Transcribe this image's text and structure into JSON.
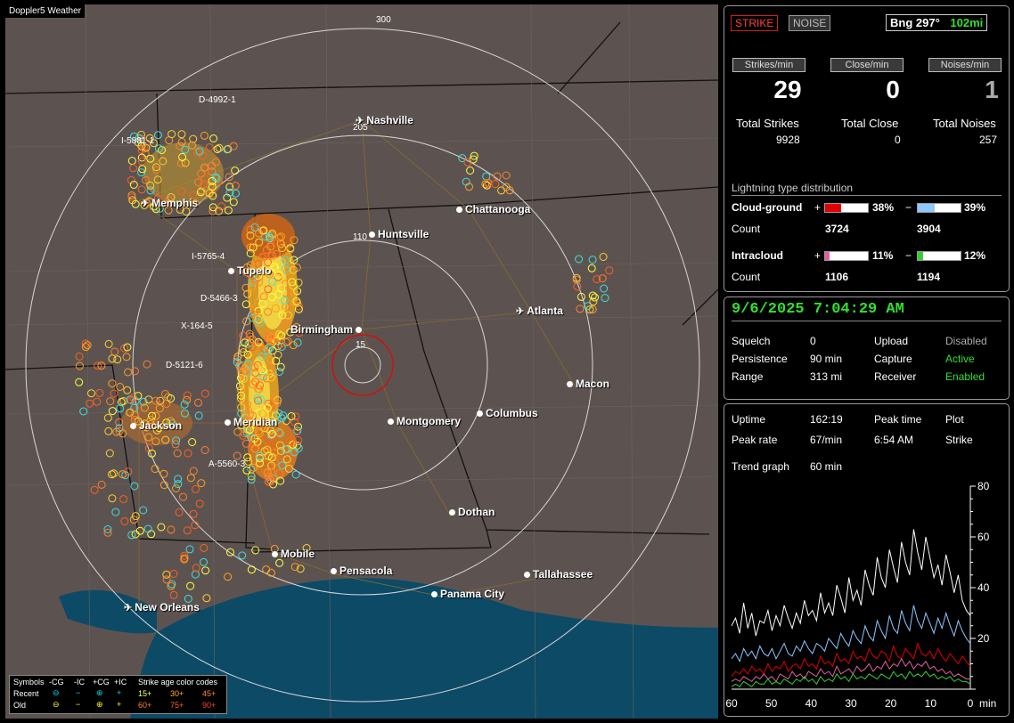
{
  "map": {
    "title": "Doppler5 Weather",
    "rings": [
      "300",
      "205",
      "110",
      "15"
    ],
    "cities": [
      {
        "name": "Nashville",
        "kind": "plane"
      },
      {
        "name": "Chattanooga",
        "kind": "dot"
      },
      {
        "name": "Memphis",
        "kind": "plane"
      },
      {
        "name": "Huntsville",
        "kind": "dot"
      },
      {
        "name": "Tupelo",
        "kind": "dot"
      },
      {
        "name": "Atlanta",
        "kind": "plane"
      },
      {
        "name": "Birmingham",
        "kind": "dot"
      },
      {
        "name": "Macon",
        "kind": "dot"
      },
      {
        "name": "Jackson",
        "kind": "dot"
      },
      {
        "name": "Meridian",
        "kind": "dot"
      },
      {
        "name": "Montgomery",
        "kind": "dot"
      },
      {
        "name": "Columbus",
        "kind": "dot"
      },
      {
        "name": "Dothan",
        "kind": "dot"
      },
      {
        "name": "Mobile",
        "kind": "dot"
      },
      {
        "name": "Pensacola",
        "kind": "dot"
      },
      {
        "name": "Tallahassee",
        "kind": "dot"
      },
      {
        "name": "Panama City",
        "kind": "dot"
      },
      {
        "name": "New Orleans",
        "kind": "plane"
      }
    ],
    "highway_labels": [
      "D-4992-1",
      "I-5881-1",
      "I-5765-4",
      "D-5466-3",
      "X-164-5",
      "D-5121-6",
      "A-5560-3"
    ],
    "legend": {
      "symbols_label": "Symbols",
      "neg_cg": "-CG",
      "neg_ic": "-IC",
      "pos_cg": "+CG",
      "pos_ic": "+IC",
      "age_title": "Strike age color codes",
      "recent": "Recent",
      "old": "Old",
      "ages_recent": [
        "15+",
        "30+",
        "45+"
      ],
      "ages_old": [
        "60+",
        "75+",
        "90+"
      ]
    }
  },
  "top": {
    "strike_btn": "STRIKE",
    "noise_btn": "NOISE",
    "bearing": "Bng 297°",
    "distance": "102mi",
    "rate_labels": [
      "Strikes/min",
      "Close/min",
      "Noises/min"
    ],
    "rates": [
      "29",
      "0",
      "1"
    ],
    "total_labels": [
      "Total Strikes",
      "Total Close",
      "Total Noises"
    ],
    "totals": [
      "9928",
      "0",
      "257"
    ],
    "dist_title": "Lightning type distribution",
    "cg_label": "Cloud-ground",
    "ic_label": "Intracloud",
    "count_label": "Count",
    "plus": "+",
    "minus": "−",
    "cg_pos_pct": "38%",
    "cg_neg_pct": "39%",
    "ic_pos_pct": "11%",
    "ic_neg_pct": "12%",
    "cg_pos_count": "3724",
    "cg_neg_count": "3904",
    "ic_pos_count": "1106",
    "ic_neg_count": "1194",
    "cg_pos_frac": 0.38,
    "cg_neg_frac": 0.39,
    "ic_pos_frac": 0.11,
    "ic_neg_frac": 0.12,
    "colors": {
      "cg_pos": "#e00000",
      "cg_neg": "#8fc8ff",
      "ic_pos": "#e060a0",
      "ic_neg": "#30d030"
    }
  },
  "status": {
    "datetime": "9/6/2025 7:04:29 AM",
    "squelch_label": "Squelch",
    "squelch": "0",
    "persistence_label": "Persistence",
    "persistence": "90 min",
    "range_label": "Range",
    "range": "313 mi",
    "upload_label": "Upload",
    "upload": "Disabled",
    "capture_label": "Capture",
    "capture": "Active",
    "receiver_label": "Receiver",
    "receiver": "Enabled"
  },
  "stats": {
    "uptime_label": "Uptime",
    "uptime": "162:19",
    "peak_time_label": "Peak time",
    "peak_time": "6:54 AM",
    "plot_label": "Plot",
    "plot": "Strike",
    "peak_rate_label": "Peak rate",
    "peak_rate": "67/min",
    "trend_label": "Trend graph",
    "trend": "60 min"
  },
  "chart_data": {
    "type": "line",
    "xlabel": "min",
    "x_ticks": [
      "60",
      "50",
      "40",
      "30",
      "20",
      "10",
      "0"
    ],
    "y_ticks": [
      "80",
      "60",
      "40",
      "20"
    ],
    "ylim": [
      0,
      80
    ],
    "xlim": [
      60,
      0
    ],
    "series": [
      {
        "color": "#ffffff",
        "values": [
          25,
          28,
          22,
          34,
          24,
          30,
          21,
          27,
          26,
          31,
          23,
          29,
          25,
          33,
          28,
          24,
          30,
          26,
          35,
          29,
          31,
          27,
          38,
          30,
          34,
          29,
          41,
          36,
          30,
          44,
          35,
          39,
          33,
          47,
          41,
          37,
          52,
          44,
          40,
          55,
          48,
          42,
          58,
          50,
          45,
          63,
          54,
          47,
          60,
          52,
          44,
          49,
          41,
          53,
          46,
          38,
          45,
          35,
          31,
          29
        ]
      },
      {
        "color": "#8fc8ff",
        "values": [
          12,
          14,
          11,
          16,
          13,
          15,
          12,
          17,
          14,
          13,
          16,
          12,
          15,
          18,
          14,
          13,
          17,
          15,
          19,
          16,
          14,
          18,
          17,
          15,
          20,
          18,
          16,
          22,
          19,
          17,
          23,
          20,
          18,
          25,
          21,
          19,
          27,
          23,
          20,
          29,
          24,
          22,
          31,
          26,
          23,
          33,
          27,
          24,
          30,
          26,
          22,
          28,
          24,
          30,
          25,
          21,
          27,
          23,
          20,
          18
        ]
      },
      {
        "color": "#e00000",
        "values": [
          5,
          7,
          6,
          8,
          6,
          9,
          7,
          8,
          6,
          10,
          7,
          9,
          8,
          11,
          7,
          9,
          10,
          8,
          12,
          9,
          10,
          8,
          13,
          10,
          11,
          9,
          14,
          11,
          12,
          10,
          15,
          12,
          13,
          11,
          16,
          13,
          12,
          15,
          14,
          11,
          17,
          13,
          12,
          16,
          14,
          12,
          18,
          14,
          13,
          15,
          12,
          16,
          13,
          11,
          14,
          12,
          10,
          13,
          11,
          9
        ]
      },
      {
        "color": "#e060a0",
        "values": [
          3,
          4,
          3,
          5,
          4,
          3,
          5,
          4,
          6,
          4,
          5,
          3,
          6,
          5,
          4,
          7,
          5,
          6,
          4,
          7,
          6,
          5,
          8,
          6,
          7,
          5,
          9,
          6,
          7,
          8,
          6,
          9,
          7,
          8,
          10,
          7,
          9,
          8,
          11,
          8,
          10,
          9,
          12,
          9,
          11,
          8,
          10,
          9,
          11,
          8,
          9,
          7,
          8,
          6,
          7,
          5,
          6,
          5,
          4,
          4
        ]
      },
      {
        "color": "#30d030",
        "values": [
          1,
          2,
          1,
          3,
          2,
          1,
          3,
          2,
          2,
          4,
          2,
          3,
          2,
          4,
          3,
          2,
          4,
          3,
          5,
          3,
          4,
          2,
          5,
          3,
          4,
          3,
          6,
          4,
          5,
          3,
          6,
          4,
          5,
          4,
          6,
          5,
          4,
          6,
          5,
          4,
          7,
          5,
          6,
          4,
          7,
          5,
          6,
          5,
          7,
          5,
          6,
          4,
          5,
          4,
          5,
          3,
          4,
          3,
          3,
          2
        ]
      }
    ]
  }
}
